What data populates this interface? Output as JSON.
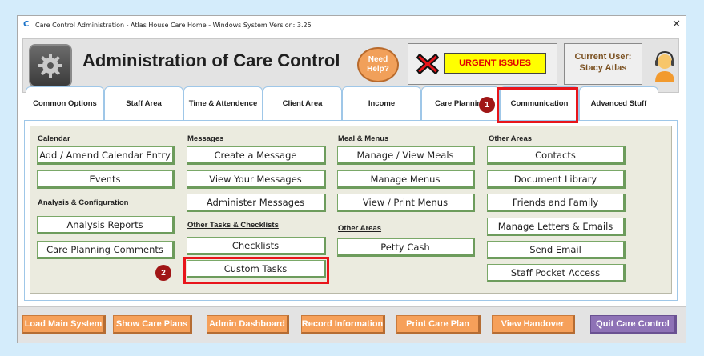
{
  "window": {
    "title": "Care Control Administration - Atlas House Care Home - Windows System Version: 3.25",
    "app_icon": "C",
    "close": "✕"
  },
  "header": {
    "logo_icon": "gear-logo-icon",
    "app_title": "Administration of Care Control",
    "help_line1": "Need",
    "help_line2": "Help?",
    "urgent_icon": "red-x-icon",
    "urgent_label": "URGENT ISSUES",
    "current_user_label": "Current User:",
    "current_user_name": "Stacy Atlas",
    "avatar_icon": "user-headset-icon"
  },
  "tabs": [
    {
      "label": "Common Options"
    },
    {
      "label": "Staff Area"
    },
    {
      "label": "Time & Attendence"
    },
    {
      "label": "Client Area"
    },
    {
      "label": "Income"
    },
    {
      "label": "Care Planning"
    },
    {
      "label": "Communication"
    },
    {
      "label": "Advanced Stuff"
    }
  ],
  "panel": {
    "col1": {
      "calendar_heading": "Calendar",
      "calendar_buttons": [
        "Add / Amend Calendar Entry",
        "Events"
      ],
      "analysis_heading": "Analysis & Configuration",
      "analysis_buttons": [
        "Analysis Reports",
        "Care Planning Comments"
      ]
    },
    "col2": {
      "messages_heading": "Messages",
      "messages_buttons": [
        "Create a Message",
        "View Your Messages",
        "Administer Messages"
      ],
      "tasks_heading": "Other Tasks & Checklists",
      "tasks_buttons": [
        "Checklists",
        "Custom Tasks"
      ]
    },
    "col3": {
      "meals_heading": "Meal & Menus",
      "meals_buttons": [
        "Manage / View Meals",
        "Manage Menus",
        "View / Print Menus"
      ],
      "other_heading": "Other Areas",
      "other_buttons": [
        "Petty Cash"
      ]
    },
    "col4": {
      "other_heading": "Other Areas",
      "other_buttons": [
        "Contacts",
        "Document Library",
        "Friends and Family",
        "Manage Letters & Emails",
        "Send Email",
        "Staff Pocket Access"
      ]
    }
  },
  "markers": [
    "1",
    "2"
  ],
  "footer": {
    "buttons": [
      "Load Main System",
      "Show Care Plans",
      "Admin Dashboard",
      "Record Information",
      "Print Care Plan",
      "View Handover",
      "Quit Care Control"
    ]
  },
  "colors": {
    "background": "#d4ecfb",
    "highlight_box": "#e8151b",
    "footer_button": "#f6a05a",
    "quit_button": "#8e72b6",
    "urgent_bg": "#ffff00",
    "urgent_text": "#e00000"
  }
}
